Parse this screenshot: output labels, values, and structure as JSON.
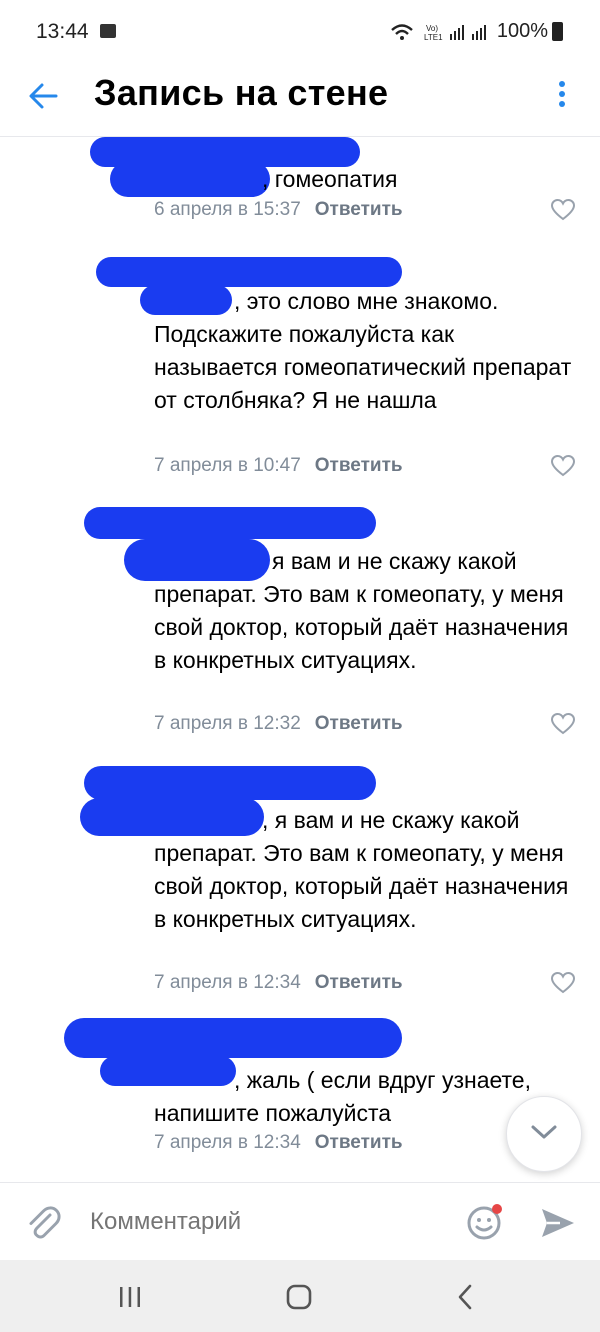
{
  "status_bar": {
    "time": "13:44",
    "network": "Vo) LTE1",
    "battery": "100%"
  },
  "header": {
    "title": "Запись на стене",
    "back_icon": "arrow-left-icon",
    "menu_icon": "more-vertical-icon",
    "accent": "#2688eb"
  },
  "comments": [
    {
      "text": ", гомеопатия",
      "date": "6 апреля в 15:37",
      "reply": "Ответить"
    },
    {
      "text": ", это слово мне знакомо. Подскажите пожалуйста как называется гомеопатический препарат от столбняка? Я не нашла",
      "date": "7 апреля в 10:47",
      "reply": "Ответить"
    },
    {
      "text": "я вам и не скажу какой препарат. Это вам к гомеопату, у меня свой доктор, который даёт назначения в конкретных ситуациях.",
      "date": "7 апреля в 12:32",
      "reply": "Ответить"
    },
    {
      "text": ", я вам и не скажу какой препарат. Это вам к гомеопату, у меня свой доктор, который даёт назначения в конкретных ситуациях.",
      "date": "7 апреля в 12:34",
      "reply": "Ответить"
    },
    {
      "text": ", жаль ( если вдруг узнаете, напишите пожалуйста",
      "date": "7 апреля в 12:34",
      "reply": "Ответить"
    }
  ],
  "comment_input": {
    "placeholder": "Комментарий"
  },
  "colors": {
    "redaction": "#1a3cf0",
    "meta_text": "#818c99"
  }
}
